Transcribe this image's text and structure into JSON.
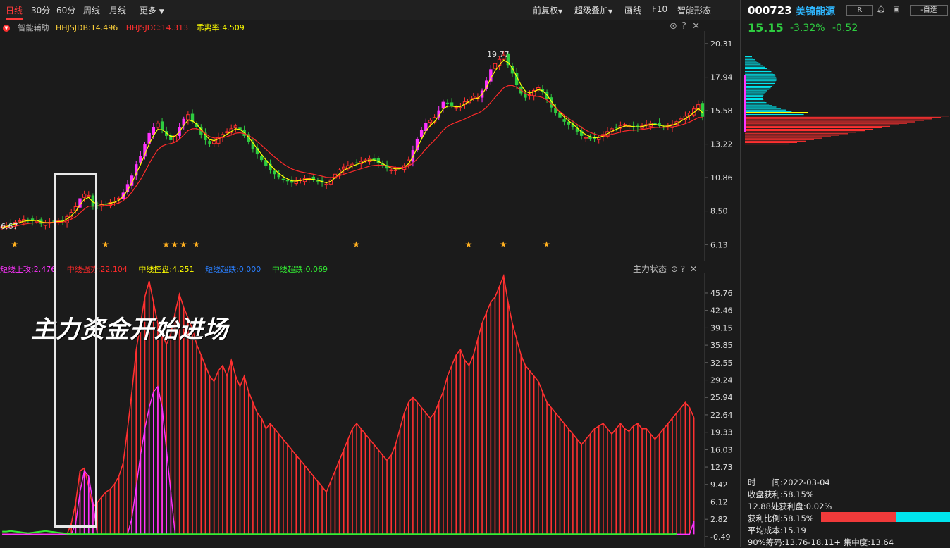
{
  "toolbar": {
    "periods": [
      "日线",
      "30分",
      "60分",
      "周线",
      "月线"
    ],
    "more": "更多",
    "right": {
      "fq": "前复权",
      "overlay": "超级叠加",
      "draw": "画线",
      "f10": "F10",
      "smart": "智能形态"
    }
  },
  "price_panel": {
    "name": "智能辅助",
    "legend": [
      {
        "text": "HHJSJDB:14.496",
        "color": "#ffd23a"
      },
      {
        "text": "HHJSJDC:14.313",
        "color": "#ff3030"
      },
      {
        "text": "乖离率:4.509",
        "color": "#ffff00"
      }
    ],
    "high_label": "19.77",
    "low_label": "6.67"
  },
  "indicator_panel": {
    "name": "主力状态",
    "legend": [
      {
        "text": "短线上攻:2.476",
        "color": "#ff33ff"
      },
      {
        "text": "中线强势:22.104",
        "color": "#ff2a2a"
      },
      {
        "text": "中线控盘:4.251",
        "color": "#ffff00"
      },
      {
        "text": "短线超跌:0.000",
        "color": "#2a7fff"
      },
      {
        "text": "中线超跌:0.069",
        "color": "#33ee33"
      }
    ],
    "caption": "主力资金开始进场"
  },
  "stock": {
    "code": "000723",
    "name": "美锦能源",
    "r_badge": "R",
    "self_select": "-自选",
    "price": "15.15",
    "change_pct": "-3.32%",
    "change": "-0.52"
  },
  "chip_info": {
    "date": "时　　间:2022-03-04",
    "profit": "收盘获利:58.15%",
    "profit_at": "12.88处获利盘:0.02%",
    "ratio": "获利比例:58.15%",
    "ratio_value": 0.5815,
    "avg_cost": "平均成本:15.19",
    "concentration": "90%筹码:13.76-18.11+ 集中度:13.64"
  },
  "colors": {
    "up": "#ff3030",
    "down": "#2ecc40",
    "ma1": "#ffff00",
    "ma2": "#ff2a2a",
    "cyan": "#00e5ee",
    "magenta": "#ff33ff"
  },
  "chart_data": [
    {
      "type": "candlestick",
      "title": "智能辅助",
      "y_ticks": [
        20.31,
        17.94,
        15.58,
        13.22,
        10.86,
        8.5,
        6.13
      ],
      "ylim": [
        5.0,
        21.2
      ],
      "x_count": 163,
      "close": [
        7.4,
        7.5,
        7.6,
        7.7,
        7.8,
        7.9,
        7.85,
        7.8,
        7.85,
        7.6,
        7.65,
        7.7,
        7.75,
        7.8,
        7.8,
        8.1,
        8.4,
        8.8,
        9.4,
        9.7,
        9.6,
        8.8,
        8.9,
        8.95,
        9.0,
        9.1,
        9.2,
        9.4,
        9.8,
        10.4,
        11.0,
        11.8,
        12.4,
        13.2,
        14.0,
        14.4,
        14.7,
        14.2,
        13.8,
        13.5,
        13.8,
        14.4,
        15.0,
        15.3,
        14.8,
        14.4,
        13.9,
        13.5,
        13.2,
        13.4,
        13.7,
        13.9,
        14.1,
        14.3,
        14.5,
        14.2,
        13.8,
        13.4,
        12.9,
        12.5,
        12.1,
        11.7,
        11.4,
        11.1,
        10.9,
        10.7,
        10.6,
        10.5,
        10.6,
        10.7,
        10.8,
        10.8,
        10.7,
        10.6,
        10.5,
        10.4,
        10.7,
        11.1,
        11.4,
        11.6,
        11.7,
        11.8,
        11.9,
        12.0,
        12.1,
        12.2,
        12.1,
        11.9,
        11.7,
        11.5,
        11.4,
        11.4,
        11.5,
        11.7,
        12.1,
        12.8,
        13.6,
        14.2,
        14.7,
        14.9,
        15.1,
        15.6,
        16.2,
        16.1,
        15.9,
        15.8,
        15.9,
        16.2,
        16.4,
        16.6,
        16.5,
        17.0,
        17.7,
        18.5,
        18.9,
        19.2,
        19.5,
        18.8,
        18.2,
        17.4,
        16.8,
        16.5,
        16.7,
        17.0,
        17.2,
        16.9,
        16.4,
        15.8,
        15.4,
        15.1,
        14.8,
        14.6,
        14.4,
        14.1,
        13.8,
        13.7,
        13.6,
        13.6,
        13.7,
        13.9,
        14.1,
        14.3,
        14.4,
        14.5,
        14.6,
        14.5,
        14.4,
        14.4,
        14.5,
        14.6,
        14.7,
        14.6,
        14.5,
        14.4,
        14.5,
        14.6,
        14.8,
        15.0,
        15.2,
        15.4,
        15.7,
        16.0,
        15.15
      ],
      "series": [
        {
          "name": "HHJSJDB",
          "color": "#ffff00",
          "values": [
            7.34,
            7.41,
            7.5,
            7.59,
            7.68,
            7.78,
            7.82,
            7.82,
            7.84,
            7.73,
            7.69,
            7.69,
            7.72,
            7.76,
            7.78,
            7.94,
            8.17,
            8.48,
            8.94,
            9.32,
            9.46,
            9.13,
            9.01,
            8.98,
            8.99,
            9.05,
            9.12,
            9.26,
            9.53,
            9.97,
            10.48,
            11.14,
            11.77,
            12.49,
            13.24,
            13.82,
            14.26,
            14.23,
            14.01,
            13.76,
            13.78,
            14.09,
            14.55,
            14.92,
            14.86,
            14.63,
            14.27,
            13.88,
            13.54,
            13.47,
            13.58,
            13.74,
            13.92,
            14.11,
            14.3,
            14.25,
            14.03,
            13.71,
            13.31,
            12.9,
            12.5,
            12.1,
            11.75,
            11.43,
            11.16,
            10.93,
            10.77,
            10.63,
            10.62,
            10.66,
            10.73,
            10.76,
            10.73,
            10.67,
            10.58,
            10.49,
            10.6,
            10.85,
            11.12,
            11.36,
            11.53,
            11.67,
            11.78,
            11.89,
            11.99,
            12.1,
            12.1,
            12.0,
            11.85,
            11.68,
            11.54,
            11.47,
            11.48,
            11.59,
            11.84,
            12.32,
            12.96,
            13.58,
            14.14,
            14.52,
            14.81,
            15.21,
            15.7,
            15.9,
            15.9,
            15.85,
            15.87,
            16.04,
            16.22,
            16.41,
            16.46,
            16.73,
            17.21,
            17.86,
            18.38,
            18.79,
            19.15,
            18.98,
            18.59,
            17.99,
            17.4,
            16.95,
            16.82,
            16.91,
            17.06,
            16.98,
            16.69,
            16.25,
            15.82,
            15.46,
            15.13,
            14.87,
            14.63,
            14.37,
            14.08,
            13.89,
            13.75,
            13.67,
            13.69,
            13.79,
            13.95,
            14.12,
            14.26,
            14.38,
            14.49,
            14.5,
            14.45,
            14.42,
            14.46,
            14.53,
            14.62,
            14.61,
            14.56,
            14.48,
            14.49,
            14.55,
            14.67,
            14.84,
            15.02,
            15.21,
            15.45,
            15.73,
            15.44
          ]
        },
        {
          "name": "HHJSJDC",
          "color": "#ff2a2a",
          "values": [
            7.3,
            7.33,
            7.38,
            7.43,
            7.5,
            7.57,
            7.62,
            7.65,
            7.68,
            7.67,
            7.67,
            7.68,
            7.69,
            7.71,
            7.72,
            7.8,
            7.92,
            8.09,
            8.37,
            8.64,
            8.84,
            8.84,
            8.86,
            8.87,
            8.89,
            8.93,
            8.98,
            9.07,
            9.23,
            9.49,
            9.83,
            10.27,
            10.72,
            11.25,
            11.85,
            12.37,
            12.83,
            13.08,
            13.21,
            13.26,
            13.35,
            13.56,
            13.87,
            14.18,
            14.3,
            14.31,
            14.17,
            13.97,
            13.75,
            13.65,
            13.64,
            13.68,
            13.75,
            13.86,
            13.99,
            14.02,
            13.96,
            13.83,
            13.63,
            13.4,
            13.14,
            12.86,
            12.58,
            12.31,
            12.06,
            11.83,
            11.64,
            11.47,
            11.36,
            11.27,
            11.21,
            11.15,
            11.09,
            11.03,
            10.96,
            10.88,
            10.86,
            10.9,
            10.99,
            11.09,
            11.19,
            11.29,
            11.38,
            11.48,
            11.57,
            11.67,
            11.72,
            11.74,
            11.72,
            11.68,
            11.63,
            11.58,
            11.57,
            11.59,
            11.67,
            11.87,
            12.17,
            12.51,
            12.88,
            13.2,
            13.5,
            13.83,
            14.2,
            14.46,
            14.63,
            14.76,
            14.86,
            14.99,
            15.13,
            15.29,
            15.39,
            15.56,
            15.81,
            16.16,
            16.52,
            16.86,
            17.19,
            17.34,
            17.36,
            17.23,
            17.02,
            16.8,
            16.66,
            16.6,
            16.59,
            16.51,
            16.33,
            16.07,
            15.78,
            15.51,
            15.26,
            15.03,
            14.82,
            14.61,
            14.39,
            14.2,
            14.05,
            13.93,
            13.85,
            13.83,
            13.85,
            13.91,
            13.98,
            14.06,
            14.14,
            14.18,
            14.2,
            14.22,
            14.25,
            14.3,
            14.35,
            14.39,
            14.4,
            14.4,
            14.41,
            14.43,
            14.48,
            14.56,
            14.66,
            14.78,
            14.93,
            15.1,
            15.09
          ]
        }
      ]
    },
    {
      "type": "bar",
      "title": "主力状态",
      "y_ticks": [
        45.76,
        42.46,
        39.15,
        35.85,
        32.55,
        29.24,
        25.94,
        22.64,
        19.33,
        16.03,
        12.73,
        9.42,
        6.12,
        2.82,
        -0.49
      ],
      "ylim": [
        -2.5,
        49.5
      ],
      "x_count": 163,
      "series": [
        {
          "name": "中线强势",
          "color": "#ff2a2a",
          "values": [
            0,
            0,
            0,
            0,
            0,
            0,
            0,
            0,
            0,
            0,
            0,
            0,
            0,
            0,
            0,
            0,
            2.0,
            6.0,
            12.0,
            12.5,
            9.0,
            5.0,
            6.0,
            7.0,
            8.0,
            8.5,
            9.5,
            11.0,
            13.5,
            20.0,
            27.0,
            35.0,
            40.0,
            45.0,
            48.0,
            44.0,
            40.0,
            38.0,
            36.0,
            38.0,
            42.0,
            45.5,
            43.0,
            41.0,
            39.0,
            36.0,
            34.0,
            32.0,
            30.0,
            29.0,
            31.0,
            32.0,
            30.0,
            33.0,
            30.0,
            28.0,
            30.0,
            27.0,
            25.0,
            23.0,
            22.0,
            20.0,
            21.0,
            20.0,
            19.0,
            18.0,
            17.0,
            16.0,
            15.0,
            14.0,
            13.0,
            12.0,
            11.0,
            10.0,
            9.0,
            8.0,
            10.0,
            12.0,
            14.0,
            16.0,
            18.0,
            20.0,
            21.0,
            20.0,
            19.0,
            18.0,
            17.0,
            16.0,
            15.0,
            14.0,
            15.0,
            17.0,
            20.0,
            23.0,
            25.0,
            26.0,
            25.0,
            24.0,
            23.0,
            22.0,
            23.0,
            25.0,
            27.0,
            30.0,
            32.0,
            34.0,
            35.0,
            33.0,
            32.0,
            34.0,
            37.0,
            40.0,
            42.0,
            44.0,
            45.0,
            47.0,
            49.0,
            44.0,
            40.0,
            37.0,
            34.0,
            32.0,
            31.0,
            30.0,
            29.0,
            27.0,
            25.0,
            24.0,
            23.0,
            22.0,
            21.0,
            20.0,
            19.0,
            18.0,
            17.0,
            18.0,
            19.0,
            20.0,
            20.5,
            21.0,
            20.0,
            19.0,
            20.0,
            21.0,
            20.0,
            19.5,
            20.5,
            21.0,
            20.0,
            20.0,
            19.0,
            18.0,
            19.0,
            20.0,
            21.0,
            22.0,
            23.0,
            24.0,
            25.0,
            24.0,
            22.1
          ]
        },
        {
          "name": "短线上攻",
          "color": "#ff33ff",
          "values": [
            0,
            0,
            0,
            0,
            0,
            0,
            0,
            0,
            0,
            0,
            0,
            0,
            0,
            0,
            0,
            0,
            0,
            2.0,
            8.0,
            12.0,
            11.0,
            6.0,
            0,
            0,
            0,
            0,
            0,
            0,
            0,
            0,
            3.0,
            9.0,
            15.0,
            20.0,
            24.0,
            27.0,
            28.0,
            24.0,
            16.0,
            8.0,
            0,
            0,
            0,
            0,
            0,
            0,
            0,
            0,
            0,
            0,
            0,
            0,
            0,
            0,
            0,
            0,
            0,
            0,
            0,
            0,
            0,
            0,
            0,
            0,
            0,
            0,
            0,
            0,
            0,
            0,
            0,
            0,
            0,
            0,
            0,
            0,
            0,
            0,
            0,
            0,
            0,
            0,
            0,
            0,
            0,
            0,
            0,
            0,
            0,
            0,
            0,
            0,
            0,
            0,
            0,
            0,
            0,
            0,
            0,
            0,
            0,
            0,
            0,
            0,
            0,
            0,
            0,
            0,
            0,
            0,
            0,
            0,
            0,
            0,
            0,
            0,
            0,
            0,
            0,
            0,
            0,
            0,
            0,
            0,
            0,
            0,
            0,
            0,
            0,
            0,
            0,
            0,
            0,
            0,
            0,
            0,
            0,
            0,
            0,
            0,
            0,
            0,
            0,
            0,
            0,
            0,
            0,
            0,
            0,
            0,
            0,
            0,
            0,
            0,
            0,
            0,
            0,
            0,
            0,
            0,
            2.476
          ]
        },
        {
          "name": "中线超跌",
          "color": "#33ee33",
          "values": [
            0.5,
            0.5,
            0.6,
            0.5,
            0.4,
            0.3,
            0.2,
            0.3,
            0.4,
            0.5,
            0.6,
            0.5,
            0.4,
            0.3,
            0.2,
            0.1,
            0,
            0,
            0,
            0,
            0,
            0,
            0,
            0,
            0,
            0,
            0,
            0,
            0,
            0,
            0,
            0,
            0,
            0,
            0,
            0,
            0,
            0,
            0,
            0,
            0,
            0,
            0,
            0,
            0,
            0,
            0,
            0,
            0,
            0,
            0,
            0,
            0,
            0,
            0,
            0,
            0,
            0,
            0,
            0,
            0,
            0,
            0,
            0,
            0,
            0,
            0,
            0,
            0,
            0,
            0,
            0,
            0,
            0,
            0,
            0,
            0,
            0,
            0,
            0,
            0,
            0,
            0,
            0,
            0,
            0,
            0,
            0,
            0,
            0,
            0,
            0,
            0,
            0,
            0,
            0,
            0,
            0,
            0,
            0,
            0,
            0,
            0,
            0,
            0,
            0,
            0,
            0,
            0,
            0,
            0,
            0,
            0,
            0,
            0,
            0,
            0,
            0,
            0,
            0,
            0,
            0,
            0,
            0,
            0,
            0,
            0,
            0,
            0,
            0,
            0,
            0,
            0,
            0,
            0,
            0,
            0,
            0,
            0,
            0,
            0,
            0,
            0,
            0,
            0,
            0,
            0,
            0,
            0,
            0,
            0,
            0,
            0,
            0,
            0,
            0,
            0.069
          ]
        }
      ]
    }
  ]
}
